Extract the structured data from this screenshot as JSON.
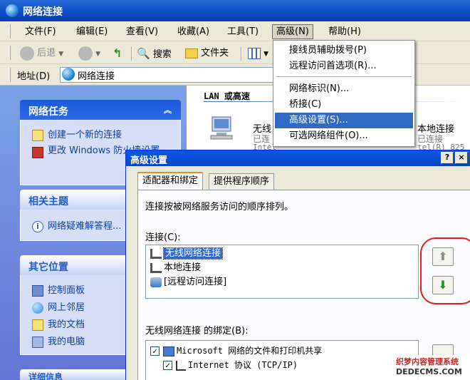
{
  "window": {
    "title": "网络连接"
  },
  "menubar": {
    "items": [
      "文件(F)",
      "编辑(E)",
      "查看(V)",
      "收藏(A)",
      "工具(T)",
      "高级(N)",
      "帮助(H)"
    ]
  },
  "toolbar": {
    "back": "后退",
    "search": "搜索",
    "folders": "文件夹"
  },
  "address": {
    "label": "地址(D)",
    "value": "网络连接"
  },
  "dropdown": {
    "items": [
      "接线员辅助拨号(P)",
      "远程访问首选项(R)...",
      "网络标识(N)...",
      "桥接(C)",
      "高级设置(S)...",
      "可选网络组件(O)..."
    ],
    "selected_index": 4
  },
  "leftpane": {
    "network_tasks": {
      "title": "网络任务",
      "items": [
        "创建一个新的连接",
        "更改 Windows 防火墙设置"
      ]
    },
    "related": {
      "title": "相关主题",
      "items": [
        "网络疑难解答程..."
      ]
    },
    "other": {
      "title": "其它位置",
      "items": [
        "控制面板",
        "网上邻居",
        "我的文档",
        "我的电脑"
      ]
    },
    "details": {
      "title": "详细信息"
    }
  },
  "main": {
    "group_title": "LAN 或高速",
    "wireless_name": "无线",
    "wireless_status": "已连",
    "wireless_device": "Intel",
    "local_name": "本地连接",
    "local_status": "已连接",
    "local_device": "tel(R) 825"
  },
  "dialog": {
    "title": "高级设置",
    "help_btn": "?",
    "close_btn": "×",
    "tabs": [
      "适配器和绑定",
      "提供程序顺序"
    ],
    "description": "连接按被网络服务访问的顺序排列。",
    "connections_label": "连接(C):",
    "connections": [
      "无线网络连接",
      "本地连接",
      "[远程访问连接]"
    ],
    "bindings_label": "无线网络连接 的绑定(B):",
    "bindings": [
      "Microsoft 网络的文件和打印机共享",
      "Internet 协议 (TCP/IP)"
    ]
  },
  "watermark": {
    "line1": "织梦内容管理系统",
    "line2": "DEDECMS.COM"
  }
}
